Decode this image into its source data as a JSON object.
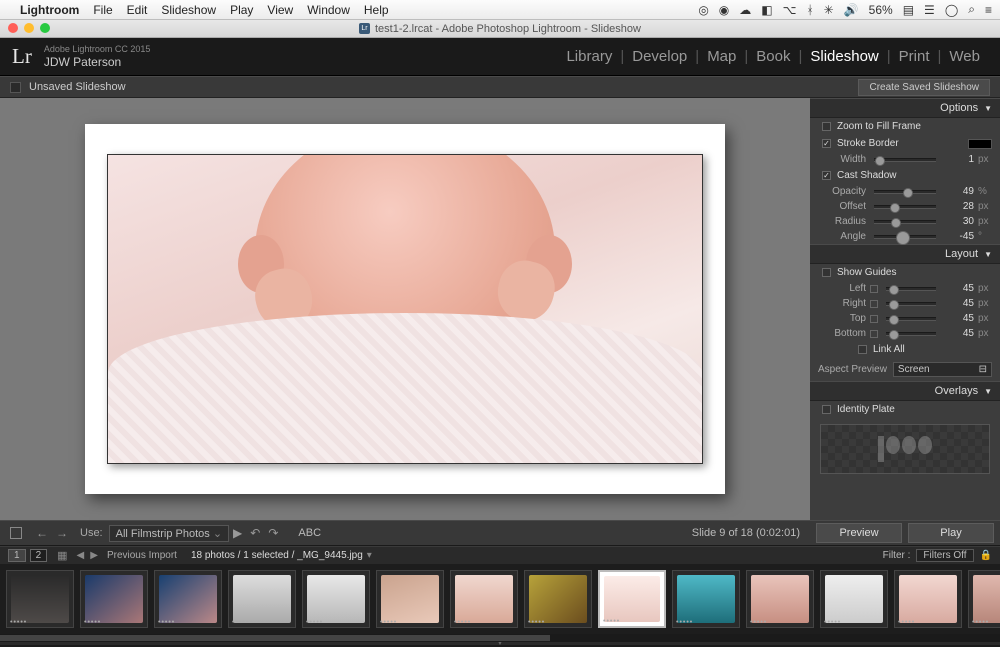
{
  "menubar": {
    "apple": "",
    "app": "Lightroom",
    "items": [
      "File",
      "Edit",
      "Slideshow",
      "Play",
      "View",
      "Window",
      "Help"
    ],
    "right_icons": [
      "◎",
      "◉",
      "☁",
      "◧",
      "⌥",
      "ᚼ",
      "✳",
      "🔊"
    ],
    "battery": "56%",
    "clock_icons": [
      "▤",
      "☰",
      "◯",
      "⌕",
      "≡"
    ]
  },
  "titlebar": {
    "doc": "test1-2.lrcat - Adobe Photoshop Lightroom - Slideshow"
  },
  "lr": {
    "logo": "Lr",
    "sub1": "Adobe Lightroom CC 2015",
    "sub2": "JDW Paterson",
    "nav": [
      "Library",
      "Develop",
      "Map",
      "Book",
      "Slideshow",
      "Print",
      "Web"
    ],
    "nav_selected": "Slideshow"
  },
  "topstrip": {
    "label": "Unsaved Slideshow",
    "button": "Create Saved Slideshow"
  },
  "panels": {
    "options": {
      "header": "Options",
      "zoom": "Zoom to Fill Frame",
      "stroke": "Stroke Border",
      "width_label": "Width",
      "width_val": "1",
      "width_unit": "px",
      "shadow": "Cast Shadow",
      "opacity_label": "Opacity",
      "opacity_val": "49",
      "opacity_unit": "%",
      "offset_label": "Offset",
      "offset_val": "28",
      "offset_unit": "px",
      "radius_label": "Radius",
      "radius_val": "30",
      "radius_unit": "px",
      "angle_label": "Angle",
      "angle_val": "-45",
      "angle_unit": "°"
    },
    "layout": {
      "header": "Layout",
      "guides": "Show Guides",
      "left": "Left",
      "right": "Right",
      "top": "Top",
      "bottom": "Bottom",
      "val": "45",
      "unit": "px",
      "linkall": "Link All",
      "aspect_label": "Aspect Preview",
      "aspect_val": "Screen"
    },
    "overlays": {
      "header": "Overlays",
      "identity": "Identity Plate"
    }
  },
  "transport": {
    "use": "Use:",
    "source": "All Filmstrip Photos",
    "abc": "ABC",
    "status": "Slide 9 of 18 (0:02:01)",
    "preview": "Preview",
    "play": "Play"
  },
  "filterbar": {
    "pages": [
      "1",
      "2"
    ],
    "label": "Previous Import",
    "count": "18 photos / 1 selected / _MG_9445.jpg",
    "filter": "Filter :",
    "filters_off": "Filters Off"
  },
  "thumbs": [
    {
      "bg": "linear-gradient(#2a2a2a,#4e4a48)"
    },
    {
      "bg": "linear-gradient(140deg,#1a3a6a,#a77)"
    },
    {
      "bg": "linear-gradient(140deg,#184071,#b88)"
    },
    {
      "bg": "linear-gradient(#ddd,#aaa)"
    },
    {
      "bg": "linear-gradient(#e8e8e8,#b7b7b7)"
    },
    {
      "bg": "linear-gradient(160deg,#caa38e,#e9c9b9)"
    },
    {
      "bg": "linear-gradient(#f0d7cf,#d9a998)"
    },
    {
      "bg": "linear-gradient(135deg,#b7a23a,#6b4d1e)"
    },
    {
      "bg": "linear-gradient(#fcece8,#e8c7bf)",
      "sel": true
    },
    {
      "bg": "linear-gradient(#4fb9c7,#1e6e7a)"
    },
    {
      "bg": "linear-gradient(#e9c4bb,#c78f82)"
    },
    {
      "bg": "linear-gradient(#eee,#ccc)"
    },
    {
      "bg": "linear-gradient(#f2d7d1,#d8aaa0)"
    },
    {
      "bg": "linear-gradient(#e0b8ae,#b7867a)"
    }
  ]
}
